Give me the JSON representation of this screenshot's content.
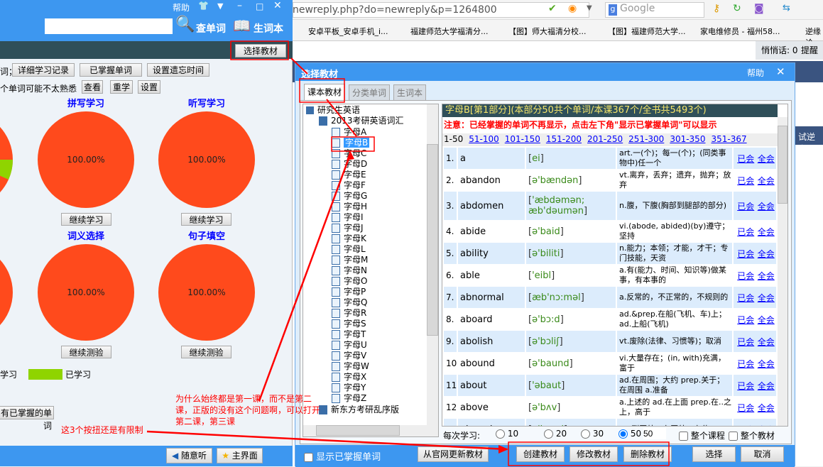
{
  "app": {
    "help": "帮助",
    "search_value": "",
    "lookup": "查单词",
    "wordbook": "生词本",
    "choose_textbook": "选择教材",
    "row1_prefix": "词；",
    "detail_record": "详细学习记录",
    "mastered_words": "已掌握单词",
    "set_forget_time": "设置遗忘时间",
    "row2_prefix": "个单词可能不太熟悉",
    "view": "查看",
    "relearn": "重学",
    "settings": "设置",
    "panels": [
      {
        "title": "拼写学习",
        "percent": "100.00%",
        "button": "继续学习"
      },
      {
        "title": "听写学习",
        "percent": "100.00%",
        "button": "继续学习"
      },
      {
        "title": "词义选择",
        "percent": "100.00%",
        "button": "继续测验"
      },
      {
        "title": "句子填空",
        "percent": "100.00%",
        "button": "继续测验"
      }
    ],
    "legend_unlearned": "未学习",
    "legend_learned": "已学习",
    "all_mastered": "有已掌握的单词",
    "random_listen": "随意听",
    "main_screen": "主界面",
    "colors": {
      "unlearned": "#ff4a1c",
      "learned": "#8fd400"
    }
  },
  "browser": {
    "url": "newreply.php?do=newreply&p=1264800",
    "search_placeholder": "Google",
    "bookmarks": [
      "安卓平板_安卓手机_i...",
      "福建师范大学福清分...",
      "【图】师大福清分校...",
      "【图】福建师范大学...",
      "家电维修员 - 福州58...",
      "逆缘论"
    ],
    "whisper": "悄悄话: 0",
    "remind": "提醒",
    "side_text": "试逆向"
  },
  "dialog": {
    "title": "选择教材",
    "help": "帮助",
    "tabs": [
      "课本教材",
      "分类单词",
      "生词本"
    ],
    "tree": {
      "root": "研究生英语",
      "book": "2013考研英语词汇",
      "lessons": [
        "字母A",
        "字母B",
        "字母C",
        "字母D",
        "字母E",
        "字母F",
        "字母G",
        "字母H",
        "字母I",
        "字母J",
        "字母K",
        "字母L",
        "字母M",
        "字母N",
        "字母O",
        "字母P",
        "字母Q",
        "字母R",
        "字母S",
        "字母T",
        "字母U",
        "字母V",
        "字母W",
        "字母X",
        "字母Y",
        "字母Z"
      ],
      "selected": "字母B",
      "next_book": "新东方考研乱序版"
    },
    "header": "字母B[第1部分](本部分50共个单词/本课367个/全书共5493个)",
    "notice": "注意：已经掌握的单词不再显示，点击左下角\"显示已掌握单词\"可以显示",
    "ranges": [
      "1-50",
      "51-100",
      "101-150",
      "151-200",
      "201-250",
      "251-300",
      "301-350",
      "351-367"
    ],
    "known": "已会",
    "all_known": "全会",
    "words": [
      {
        "n": "1.",
        "w": "a",
        "p": "ei",
        "d": "art.一(个)；每一(个)；(同类事物中)任一个"
      },
      {
        "n": "2.",
        "w": "abandon",
        "p": "ə'bændən",
        "d": "vt.离弃，丢弃；遗弃，抛弃；放弃"
      },
      {
        "n": "3.",
        "w": "abdomen",
        "p": "'æbdəmən; æb'dəumən",
        "d": "n.腹，下腹(胸部到腿部的部分)"
      },
      {
        "n": "4.",
        "w": "abide",
        "p": "ə'baid",
        "d": "vi.(abode, abided)(by)遵守；坚持"
      },
      {
        "n": "5.",
        "w": "ability",
        "p": "ə'biliti",
        "d": "n.能力；本领；才能，才干；专门技能，天资"
      },
      {
        "n": "6.",
        "w": "able",
        "p": "'eibl",
        "d": "a.有(能力、时间、知识等)做某事，有本事的"
      },
      {
        "n": "7.",
        "w": "abnormal",
        "p": "æb'nɔ:məl",
        "d": "a.反常的，不正常的，不规则的"
      },
      {
        "n": "8.",
        "w": "aboard",
        "p": "ə'bɔ:d",
        "d": "ad.&prep.在船(飞机、车)上；ad.上船(飞机)"
      },
      {
        "n": "9.",
        "w": "abolish",
        "p": "ə'bɔliʃ",
        "d": "vt.废除(法律、习惯等)；取消"
      },
      {
        "n": "10.",
        "w": "abound",
        "p": "ə'baund",
        "d": "vi.大量存在；(in, with)充满，富于"
      },
      {
        "n": "11.",
        "w": "about",
        "p": "'əbaut",
        "d": "ad.在周围；大约 prep.关于；在周围 a.准备"
      },
      {
        "n": "12.",
        "w": "above",
        "p": "ə'bʌv",
        "d": "a.上述的 ad.在上面 prep.在..之上，高于"
      },
      {
        "n": "13.",
        "w": "abroad",
        "p": "ə'brɔ:d",
        "d": "ad.到国外，在国外；在传"
      }
    ],
    "per_study": "每次学习:",
    "options": [
      "10",
      "20",
      "30",
      "50"
    ],
    "selected_option": "50",
    "custom_value": "50",
    "whole_course": "整个课程",
    "whole_book": "整个教材",
    "show_mastered": "显示已掌握单词",
    "update_official": "从官网更新教材",
    "create": "创建教材",
    "modify": "修改教材",
    "delete": "删除教材",
    "select": "选择",
    "cancel": "取消"
  },
  "annotations": {
    "note1": "为什么始终都是第一课，而不是第二课，正版的没有这个问题啊，可以打开第二课，第三课",
    "note2": "这3个按扭还是有限制"
  }
}
